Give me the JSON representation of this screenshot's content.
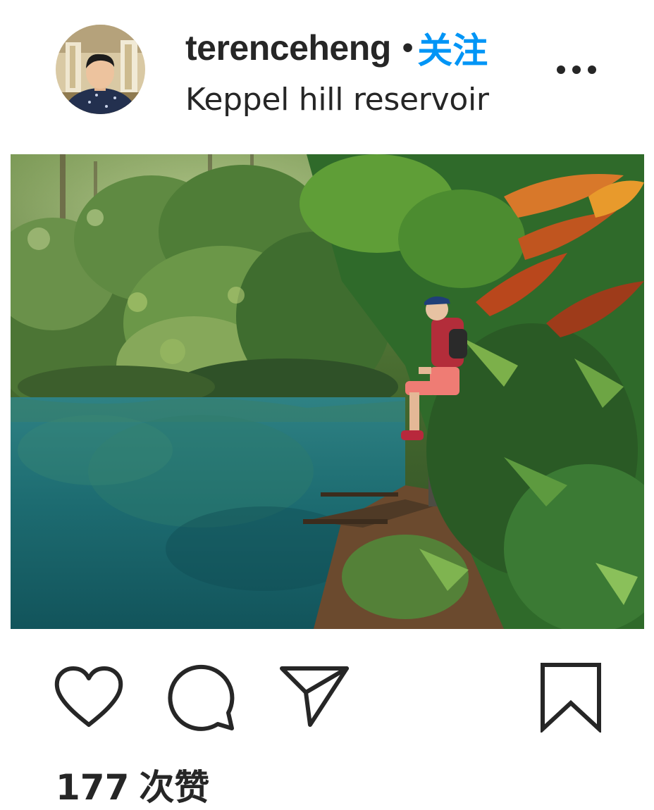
{
  "post": {
    "author": {
      "username": "terenceheng",
      "separator": "•",
      "follow_label": "关注",
      "location": "Keppel hill reservoir"
    },
    "icons": {
      "more": "more-horizontal-icon",
      "like": "heart-outline-icon",
      "comment": "comment-bubble-icon",
      "share": "paper-plane-icon",
      "save": "bookmark-outline-icon"
    },
    "likes": {
      "count": "177",
      "suffix": "次赞"
    },
    "colors": {
      "text": "#262626",
      "follow_blue": "#0095f6",
      "water": "#1f6f73",
      "foliage": "#3f7a2c"
    }
  }
}
